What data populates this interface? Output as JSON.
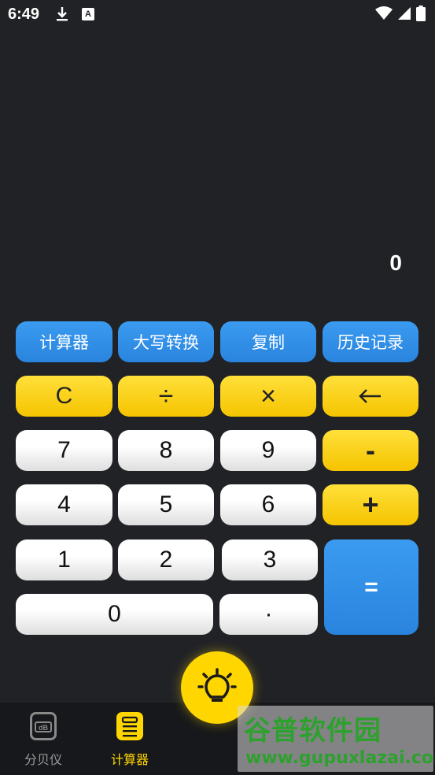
{
  "status_bar": {
    "time": "6:49",
    "notification_badge": "A"
  },
  "display": {
    "value": "0"
  },
  "function_row": [
    "计算器",
    "大写转换",
    "复制",
    "历史记录"
  ],
  "keys": {
    "clear": "C",
    "divide": "÷",
    "multiply": "×",
    "seven": "7",
    "eight": "8",
    "nine": "9",
    "minus": "-",
    "four": "4",
    "five": "5",
    "six": "6",
    "plus": "+",
    "one": "1",
    "two": "2",
    "three": "3",
    "equals": "=",
    "zero": "0",
    "dot": "·"
  },
  "nav": {
    "item1": "分贝仪",
    "item2": "计算器",
    "active": "计算器"
  },
  "watermark": {
    "title": "谷普软件园",
    "url": "www.gupuxlazai.com"
  },
  "colors": {
    "background": "#212226",
    "accent_yellow": "#ffd600",
    "accent_blue": "#3a9bf0"
  }
}
